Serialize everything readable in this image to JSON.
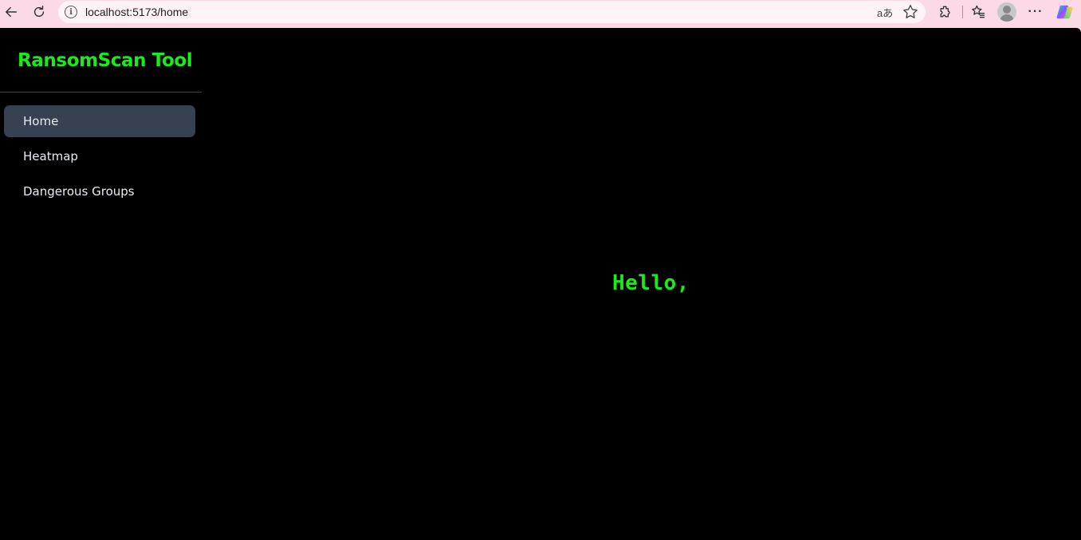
{
  "browser": {
    "url": "localhost:5173/home",
    "read_aloud_label": "aあ",
    "more_label": "···"
  },
  "sidebar": {
    "brand": "RansomScan Tool",
    "items": [
      {
        "label": "Home",
        "active": true
      },
      {
        "label": "Heatmap",
        "active": false
      },
      {
        "label": "Dangerous Groups",
        "active": false
      }
    ]
  },
  "main": {
    "greeting": "Hello,"
  },
  "colors": {
    "accent_green": "#1bea1b",
    "active_nav_bg": "#374151",
    "chrome_pink": "#fbd9e6"
  }
}
